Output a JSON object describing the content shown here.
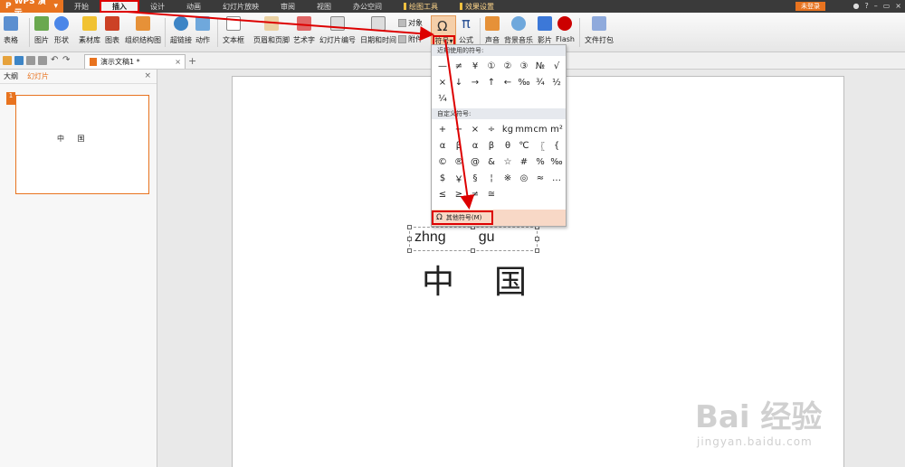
{
  "menubar": {
    "app": "WPS 演示",
    "tabs": [
      "开始",
      "插入",
      "设计",
      "动画",
      "幻灯片放映",
      "审阅",
      "视图",
      "办公空间",
      "绘图工具",
      "效果设置"
    ],
    "active_tab": "插入",
    "login": "未登录"
  },
  "ribbon": {
    "items": [
      "表格",
      "图片",
      "形状",
      "素材库",
      "图表",
      "组织结构图",
      "超链接",
      "动作",
      "文本框",
      "页眉和页脚",
      "艺术字",
      "幻灯片编号",
      "日期和时间",
      "公式",
      "声音",
      "背景音乐",
      "影片",
      "Flash",
      "文件打包"
    ],
    "object": "对象",
    "attach": "附件",
    "symbol": "符号"
  },
  "document": {
    "tab_title": "演示文稿1 *"
  },
  "left_panel": {
    "tab_outline": "大纲",
    "tab_slides": "幻灯片",
    "slide_number": "1",
    "thumb_text": "中 国"
  },
  "slide": {
    "pinyin_1": "zhng",
    "pinyin_2": "gu",
    "chinese_1": "中",
    "chinese_2": "国"
  },
  "symbol_menu": {
    "recent_title": "近期使用的符号:",
    "recent": [
      "—",
      "≠",
      "¥",
      "①",
      "②",
      "③",
      "№",
      "√",
      "×",
      "↓",
      "→",
      "↑",
      "←",
      "‰",
      "¾",
      "½",
      "¼"
    ],
    "custom_title": "自定义符号:",
    "custom": [
      "+",
      "−",
      "×",
      "÷",
      "kg",
      "mm",
      "cm",
      "m²",
      "α",
      "β",
      "α",
      "β",
      "θ",
      "℃",
      "〖",
      "{",
      "©",
      "®",
      "@",
      "&",
      "☆",
      "#",
      "%",
      "‰",
      "$",
      "￥",
      "§",
      "¦",
      "※",
      "◎",
      "≈",
      "…",
      "≤",
      "≥",
      "≠",
      "≅"
    ],
    "more": "其他符号(M)"
  },
  "watermark": {
    "brand": "Bai 经验",
    "url": "jingyan.baidu.com"
  },
  "colors": {
    "accent": "#e8731f",
    "annotation": "#dd0000"
  }
}
